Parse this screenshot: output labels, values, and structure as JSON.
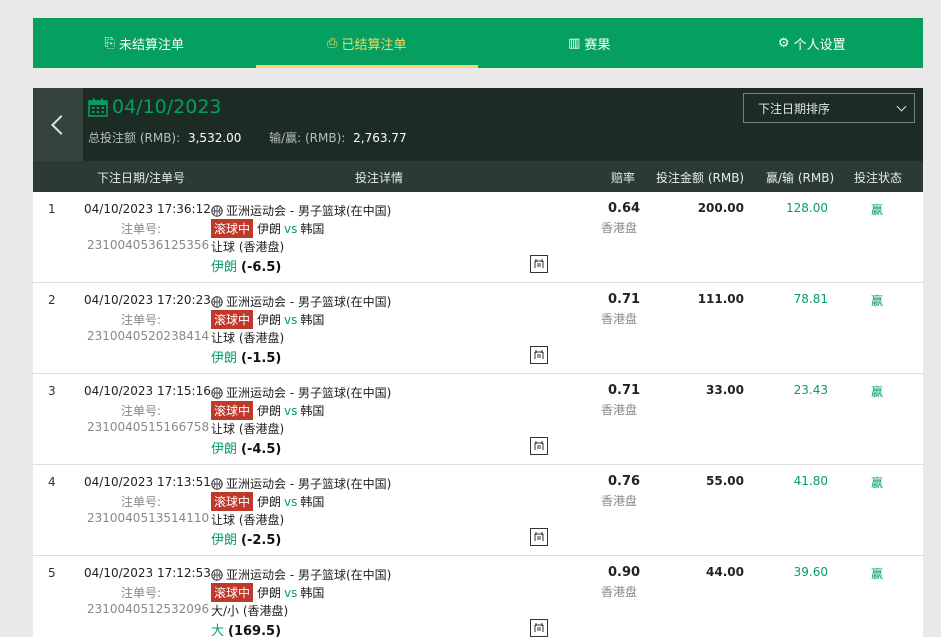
{
  "tabs": [
    {
      "icon": "⎘",
      "label": "未结算注单"
    },
    {
      "icon": "⎙",
      "label": "已结算注单"
    },
    {
      "icon": "▥",
      "label": "赛果"
    },
    {
      "icon": "⚙",
      "label": "个人设置"
    }
  ],
  "header": {
    "date": "04/10/2023",
    "total_label": "总投注额 (RMB):",
    "total_value": "3,532.00",
    "winloss_label": "输/赢: (RMB):",
    "winloss_value": "2,763.77",
    "sort_label": "下注日期排序"
  },
  "columns": {
    "date_ticket": "下注日期/注单号",
    "details": "投注详情",
    "odds": "赔率",
    "stake": "投注金额 (RMB)",
    "winloss": "赢/输 (RMB)",
    "status": "投注状态"
  },
  "rows": [
    {
      "idx": "1",
      "datetime": "04/10/2023 17:36:12",
      "ticket_label": "注单号:",
      "ticket": "2310040536125356",
      "league": "亚洲运动会 - 男子篮球(在中国)",
      "live": "滚球中",
      "home": "伊朗",
      "vs": "vs",
      "away": "韩国",
      "market": "让球 (香港盘)",
      "side": "伊朗",
      "handicap": "(-6.5)",
      "odds": "0.64",
      "odds_type": "香港盘",
      "stake": "200.00",
      "winloss": "128.00",
      "status": "赢"
    },
    {
      "idx": "2",
      "datetime": "04/10/2023 17:20:23",
      "ticket_label": "注单号:",
      "ticket": "2310040520238414",
      "league": "亚洲运动会 - 男子篮球(在中国)",
      "live": "滚球中",
      "home": "伊朗",
      "vs": "vs",
      "away": "韩国",
      "market": "让球 (香港盘)",
      "side": "伊朗",
      "handicap": "(-1.5)",
      "odds": "0.71",
      "odds_type": "香港盘",
      "stake": "111.00",
      "winloss": "78.81",
      "status": "赢"
    },
    {
      "idx": "3",
      "datetime": "04/10/2023 17:15:16",
      "ticket_label": "注单号:",
      "ticket": "2310040515166758",
      "league": "亚洲运动会 - 男子篮球(在中国)",
      "live": "滚球中",
      "home": "伊朗",
      "vs": "vs",
      "away": "韩国",
      "market": "让球 (香港盘)",
      "side": "伊朗",
      "handicap": "(-4.5)",
      "odds": "0.71",
      "odds_type": "香港盘",
      "stake": "33.00",
      "winloss": "23.43",
      "status": "赢"
    },
    {
      "idx": "4",
      "datetime": "04/10/2023 17:13:51",
      "ticket_label": "注单号:",
      "ticket": "2310040513514110",
      "league": "亚洲运动会 - 男子篮球(在中国)",
      "live": "滚球中",
      "home": "伊朗",
      "vs": "vs",
      "away": "韩国",
      "market": "让球 (香港盘)",
      "side": "伊朗",
      "handicap": "(-2.5)",
      "odds": "0.76",
      "odds_type": "香港盘",
      "stake": "55.00",
      "winloss": "41.80",
      "status": "赢"
    },
    {
      "idx": "5",
      "datetime": "04/10/2023 17:12:53",
      "ticket_label": "注单号:",
      "ticket": "2310040512532096",
      "league": "亚洲运动会 - 男子篮球(在中国)",
      "live": "滚球中",
      "home": "伊朗",
      "vs": "vs",
      "away": "韩国",
      "market": "大/小 (香港盘)",
      "side": "大",
      "handicap": "(169.5)",
      "odds": "0.90",
      "odds_type": "香港盘",
      "stake": "44.00",
      "winloss": "39.60",
      "status": "赢"
    }
  ],
  "colors": {
    "brand_green": "#05a060",
    "active_tab": "#f3d866",
    "live_red": "#c0372b",
    "panel_dark": "#1d2b25"
  }
}
